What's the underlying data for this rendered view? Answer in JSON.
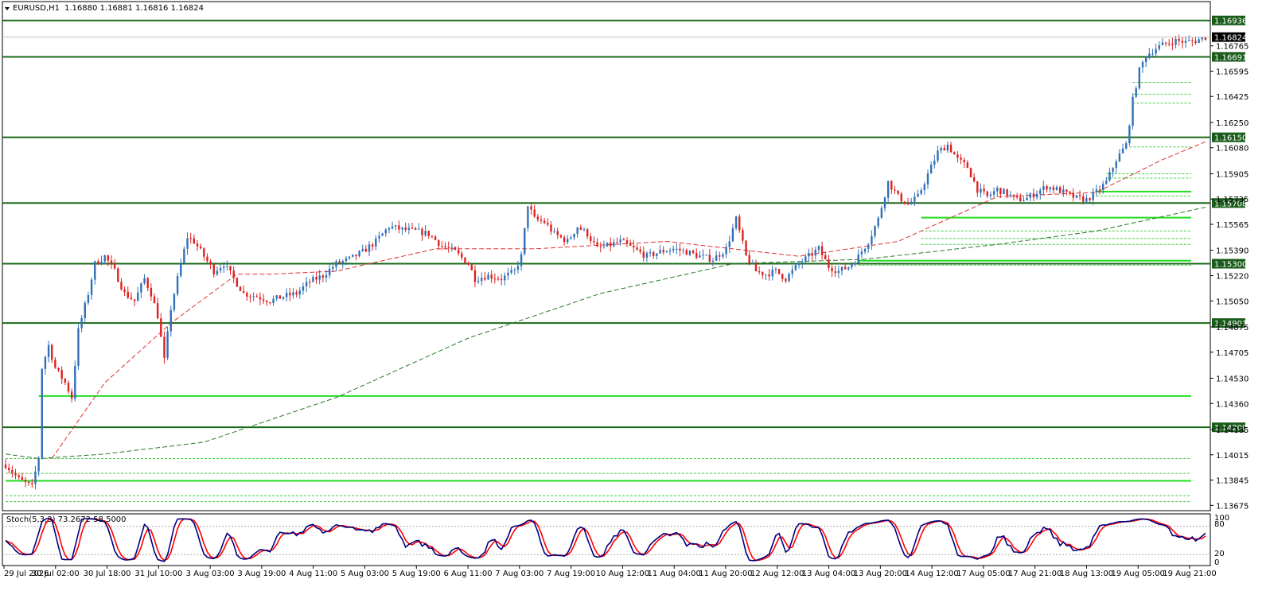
{
  "header": {
    "symbol": "EURUSD,H1",
    "ohlc": "1.16880 1.16881 1.16816 1.16824"
  },
  "stoch": {
    "label": "Stoch(5,3,3) 73.2672 58.5000",
    "levels_labels": [
      "100",
      "80",
      "20",
      "0"
    ]
  },
  "colors": {
    "bull": "#3070b8",
    "bear": "#e02020",
    "level": "#1a6b1a",
    "zone": "#22dd22",
    "zone_dash": "#44cc44",
    "ma_fast": "#e03030",
    "ma_slow": "#2a7a2a",
    "stoch_main": "#000080",
    "stoch_signal": "#ff0000"
  },
  "chart_data": {
    "type": "candlestick",
    "symbol": "EURUSD",
    "timeframe": "H1",
    "ylim": [
      1.1365,
      1.1702
    ],
    "current_price": 1.16824,
    "y_ticks": [
      "1.16765",
      "1.16595",
      "1.16425",
      "1.16250",
      "1.16080",
      "1.15905",
      "1.15735",
      "1.15565",
      "1.15390",
      "1.15220",
      "1.15050",
      "1.14875",
      "1.14705",
      "1.14530",
      "1.14360",
      "1.14185",
      "1.14015",
      "1.13845",
      "1.13675"
    ],
    "x_ticks": [
      "29 Jul 2026",
      "30 Jul 02:00",
      "30 Jul 18:00",
      "31 Jul 10:00",
      "3 Aug 03:00",
      "3 Aug 19:00",
      "4 Aug 11:00",
      "5 Aug 03:00",
      "5 Aug 19:00",
      "6 Aug 11:00",
      "7 Aug 03:00",
      "7 Aug 19:00",
      "10 Aug 12:00",
      "11 Aug 04:00",
      "11 Aug 20:00",
      "12 Aug 12:00",
      "13 Aug 04:00",
      "13 Aug 20:00",
      "14 Aug 12:00",
      "17 Aug 05:00",
      "17 Aug 21:00",
      "18 Aug 13:00",
      "19 Aug 05:00",
      "19 Aug 21:00"
    ],
    "levels": [
      {
        "price": 1.16936,
        "label": "1.16936"
      },
      {
        "price": 1.16691,
        "label": "1.16691"
      },
      {
        "price": 1.1615,
        "label": "1.16150"
      },
      {
        "price": 1.15708,
        "label": "1.15708"
      },
      {
        "price": 1.153,
        "label": "1.15300"
      },
      {
        "price": 1.14901,
        "label": "1.14901"
      },
      {
        "price": 1.142,
        "label": "1.14200"
      }
    ],
    "price_anchors": [
      [
        0,
        1.1395
      ],
      [
        4,
        1.1385
      ],
      [
        8,
        1.138
      ],
      [
        10,
        1.14
      ],
      [
        11,
        1.146
      ],
      [
        13,
        1.1475
      ],
      [
        15,
        1.146
      ],
      [
        18,
        1.145
      ],
      [
        20,
        1.144
      ],
      [
        22,
        1.1485
      ],
      [
        25,
        1.151
      ],
      [
        27,
        1.153
      ],
      [
        30,
        1.1535
      ],
      [
        33,
        1.1525
      ],
      [
        36,
        1.151
      ],
      [
        39,
        1.1505
      ],
      [
        42,
        1.152
      ],
      [
        44,
        1.151
      ],
      [
        46,
        1.1495
      ],
      [
        48,
        1.1465
      ],
      [
        50,
        1.15
      ],
      [
        53,
        1.153
      ],
      [
        55,
        1.1548
      ],
      [
        57,
        1.1545
      ],
      [
        60,
        1.1535
      ],
      [
        63,
        1.1525
      ],
      [
        66,
        1.153
      ],
      [
        69,
        1.152
      ],
      [
        72,
        1.151
      ],
      [
        76,
        1.1508
      ],
      [
        80,
        1.1505
      ],
      [
        84,
        1.1508
      ],
      [
        88,
        1.151
      ],
      [
        92,
        1.1518
      ],
      [
        96,
        1.1522
      ],
      [
        100,
        1.153
      ],
      [
        104,
        1.1533
      ],
      [
        108,
        1.1538
      ],
      [
        112,
        1.1545
      ],
      [
        116,
        1.1555
      ],
      [
        120,
        1.1553
      ],
      [
        124,
        1.1552
      ],
      [
        128,
        1.155
      ],
      [
        132,
        1.1542
      ],
      [
        136,
        1.1538
      ],
      [
        140,
        1.153
      ],
      [
        142,
        1.152
      ],
      [
        146,
        1.1522
      ],
      [
        150,
        1.152
      ],
      [
        154,
        1.1525
      ],
      [
        156,
        1.1535
      ],
      [
        158,
        1.157
      ],
      [
        160,
        1.156
      ],
      [
        163,
        1.1558
      ],
      [
        166,
        1.155
      ],
      [
        170,
        1.1545
      ],
      [
        173,
        1.1555
      ],
      [
        176,
        1.155
      ],
      [
        179,
        1.154
      ],
      [
        182,
        1.1542
      ],
      [
        186,
        1.1545
      ],
      [
        190,
        1.154
      ],
      [
        194,
        1.1535
      ],
      [
        198,
        1.1538
      ],
      [
        202,
        1.154
      ],
      [
        206,
        1.1538
      ],
      [
        210,
        1.1535
      ],
      [
        214,
        1.1533
      ],
      [
        218,
        1.154
      ],
      [
        221,
        1.156
      ],
      [
        224,
        1.1535
      ],
      [
        227,
        1.1525
      ],
      [
        230,
        1.1523
      ],
      [
        233,
        1.1525
      ],
      [
        236,
        1.152
      ],
      [
        240,
        1.153
      ],
      [
        243,
        1.1535
      ],
      [
        246,
        1.154
      ],
      [
        249,
        1.1528
      ],
      [
        252,
        1.1525
      ],
      [
        255,
        1.1528
      ],
      [
        258,
        1.1535
      ],
      [
        261,
        1.1545
      ],
      [
        264,
        1.156
      ],
      [
        267,
        1.1585
      ],
      [
        270,
        1.1575
      ],
      [
        273,
        1.157
      ],
      [
        276,
        1.1575
      ],
      [
        279,
        1.159
      ],
      [
        282,
        1.1605
      ],
      [
        285,
        1.161
      ],
      [
        288,
        1.16
      ],
      [
        291,
        1.1595
      ],
      [
        294,
        1.158
      ],
      [
        297,
        1.1575
      ],
      [
        300,
        1.158
      ],
      [
        303,
        1.1577
      ],
      [
        306,
        1.1573
      ],
      [
        309,
        1.1574
      ],
      [
        312,
        1.1578
      ],
      [
        315,
        1.1582
      ],
      [
        318,
        1.158
      ],
      [
        321,
        1.1577
      ],
      [
        324,
        1.1574
      ],
      [
        327,
        1.1573
      ],
      [
        330,
        1.1578
      ],
      [
        333,
        1.1585
      ],
      [
        336,
        1.16
      ],
      [
        339,
        1.161
      ],
      [
        341,
        1.164
      ],
      [
        343,
        1.166
      ],
      [
        345,
        1.167
      ],
      [
        348,
        1.1675
      ],
      [
        351,
        1.1678
      ],
      [
        354,
        1.168
      ],
      [
        357,
        1.1679
      ],
      [
        360,
        1.168
      ],
      [
        363,
        1.16824
      ]
    ],
    "zones": [
      {
        "price": 1.1441,
        "from": 10,
        "style": "solid"
      },
      {
        "price": 1.1384,
        "from": 0,
        "style": "solid"
      },
      {
        "price": 1.1399,
        "from": 0,
        "style": "dashed"
      },
      {
        "price": 1.1389,
        "from": 0,
        "style": "dashed"
      },
      {
        "price": 1.1374,
        "from": 0,
        "style": "dashed"
      },
      {
        "price": 1.137,
        "from": 0,
        "style": "dashed"
      },
      {
        "price": 1.1561,
        "from": 277,
        "style": "solid"
      },
      {
        "price": 1.1552,
        "from": 277,
        "style": "dashed"
      },
      {
        "price": 1.1547,
        "from": 277,
        "style": "dashed"
      },
      {
        "price": 1.1543,
        "from": 277,
        "style": "dashed"
      },
      {
        "price": 1.1532,
        "from": 258,
        "style": "solid"
      },
      {
        "price": 1.1529,
        "from": 258,
        "style": "dashed"
      },
      {
        "price": 1.15785,
        "from": 330,
        "style": "solid"
      },
      {
        "price": 1.15755,
        "from": 330,
        "style": "dashed"
      },
      {
        "price": 1.15875,
        "from": 333,
        "style": "dashed"
      },
      {
        "price": 1.15905,
        "from": 333,
        "style": "dashed"
      },
      {
        "price": 1.16085,
        "from": 340,
        "style": "dashed"
      },
      {
        "price": 1.1652,
        "from": 341,
        "style": "dashed"
      },
      {
        "price": 1.1644,
        "from": 341,
        "style": "dashed"
      },
      {
        "price": 1.1638,
        "from": 341,
        "style": "dashed"
      }
    ],
    "ma_fast_anchors": [
      [
        14,
        1.1399
      ],
      [
        30,
        1.145
      ],
      [
        50,
        1.149
      ],
      [
        70,
        1.1523
      ],
      [
        80,
        1.1523
      ],
      [
        100,
        1.1525
      ],
      [
        130,
        1.154
      ],
      [
        160,
        1.154
      ],
      [
        200,
        1.1545
      ],
      [
        240,
        1.1535
      ],
      [
        270,
        1.1545
      ],
      [
        300,
        1.1575
      ],
      [
        330,
        1.1578
      ],
      [
        350,
        1.16
      ],
      [
        363,
        1.1612
      ]
    ],
    "ma_slow_anchors": [
      [
        0,
        1.1402
      ],
      [
        10,
        1.1399
      ],
      [
        30,
        1.1402
      ],
      [
        60,
        1.141
      ],
      [
        100,
        1.144
      ],
      [
        140,
        1.148
      ],
      [
        180,
        1.151
      ],
      [
        220,
        1.153
      ],
      [
        260,
        1.1533
      ],
      [
        300,
        1.1543
      ],
      [
        330,
        1.1552
      ],
      [
        363,
        1.1568
      ]
    ],
    "stoch_range": [
      0,
      100
    ],
    "stoch_levels": [
      80,
      20
    ]
  }
}
